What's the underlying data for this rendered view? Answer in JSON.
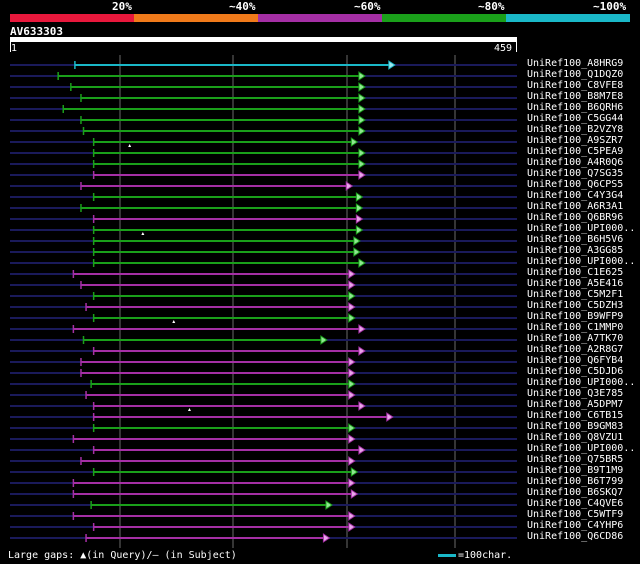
{
  "scale": {
    "labels": [
      "20%",
      "~40%",
      "~60%",
      "~80%",
      "~100%"
    ],
    "colors": [
      "#e8183c",
      "#f07a1a",
      "#a52fa5",
      "#1aa01a",
      "#1ab8c8"
    ]
  },
  "query": {
    "name": "AV633303",
    "start": "1",
    "end": "459",
    "length": 459
  },
  "colors": {
    "cyan": "#1ab8c8",
    "green": "#1aa01a",
    "purple": "#a52fa5",
    "navy": "#1a1a5a",
    "grid": "#6a6a6a"
  },
  "hits": [
    {
      "label": "UniRef100_A8HRG9",
      "start": 128,
      "end": 759,
      "color": "cyan"
    },
    {
      "label": "UniRef100_Q1DQZ0",
      "start": 95,
      "end": 700,
      "color": "green"
    },
    {
      "label": "UniRef100_C8VFE8",
      "start": 120,
      "end": 700,
      "color": "green"
    },
    {
      "label": "UniRef100_B8M7E8",
      "start": 140,
      "end": 700,
      "color": "green"
    },
    {
      "label": "UniRef100_B6QRH6",
      "start": 105,
      "end": 700,
      "color": "green"
    },
    {
      "label": "UniRef100_C5GG44",
      "start": 140,
      "end": 700,
      "color": "green"
    },
    {
      "label": "UniRef100_B2VZY8",
      "start": 145,
      "end": 700,
      "color": "green"
    },
    {
      "label": "UniRef100_A9SZR7",
      "start": 165,
      "end": 685,
      "color": "green"
    },
    {
      "label": "UniRef100_C5PEA9",
      "start": 165,
      "end": 700,
      "color": "green",
      "gap": 236
    },
    {
      "label": "UniRef100_A4R0Q6",
      "start": 165,
      "end": 700,
      "color": "green"
    },
    {
      "label": "UniRef100_Q7SG35",
      "start": 165,
      "end": 700,
      "color": "purple"
    },
    {
      "label": "UniRef100_Q6CPS5",
      "start": 140,
      "end": 675,
      "color": "purple"
    },
    {
      "label": "UniRef100_C4Y3G4",
      "start": 165,
      "end": 695,
      "color": "green"
    },
    {
      "label": "UniRef100_A6R3A1",
      "start": 140,
      "end": 695,
      "color": "green"
    },
    {
      "label": "UniRef100_Q6BR96",
      "start": 165,
      "end": 695,
      "color": "purple"
    },
    {
      "label": "UniRef100_UPI000..",
      "start": 165,
      "end": 695,
      "color": "green"
    },
    {
      "label": "UniRef100_B6H5V6",
      "start": 165,
      "end": 690,
      "color": "green",
      "gap": 262
    },
    {
      "label": "UniRef100_A3GG85",
      "start": 165,
      "end": 690,
      "color": "green"
    },
    {
      "label": "UniRef100_UPI000..",
      "start": 165,
      "end": 700,
      "color": "green"
    },
    {
      "label": "UniRef100_C1E625",
      "start": 125,
      "end": 680,
      "color": "purple"
    },
    {
      "label": "UniRef100_A5E416",
      "start": 140,
      "end": 680,
      "color": "purple"
    },
    {
      "label": "UniRef100_C5M2F1",
      "start": 165,
      "end": 680,
      "color": "green"
    },
    {
      "label": "UniRef100_C5DZH3",
      "start": 150,
      "end": 680,
      "color": "purple"
    },
    {
      "label": "UniRef100_B9WFP9",
      "start": 165,
      "end": 680,
      "color": "green"
    },
    {
      "label": "UniRef100_C1MMP0",
      "start": 125,
      "end": 700,
      "color": "purple",
      "gap": 323
    },
    {
      "label": "UniRef100_A7TK70",
      "start": 145,
      "end": 625,
      "color": "green"
    },
    {
      "label": "UniRef100_A2R8G7",
      "start": 165,
      "end": 700,
      "color": "purple"
    },
    {
      "label": "UniRef100_Q6FYB4",
      "start": 140,
      "end": 680,
      "color": "purple"
    },
    {
      "label": "UniRef100_C5DJD6",
      "start": 140,
      "end": 680,
      "color": "purple"
    },
    {
      "label": "UniRef100_UPI000..",
      "start": 160,
      "end": 680,
      "color": "green"
    },
    {
      "label": "UniRef100_Q3E785",
      "start": 150,
      "end": 680,
      "color": "purple"
    },
    {
      "label": "UniRef100_A5DPM7",
      "start": 165,
      "end": 700,
      "color": "purple"
    },
    {
      "label": "UniRef100_C6TB15",
      "start": 165,
      "end": 755,
      "color": "purple",
      "gap": 354
    },
    {
      "label": "UniRef100_B9GM83",
      "start": 165,
      "end": 680,
      "color": "green"
    },
    {
      "label": "UniRef100_Q8VZU1",
      "start": 125,
      "end": 680,
      "color": "purple"
    },
    {
      "label": "UniRef100_UPI000..",
      "start": 165,
      "end": 700,
      "color": "purple"
    },
    {
      "label": "UniRef100_Q75BR5",
      "start": 140,
      "end": 680,
      "color": "purple"
    },
    {
      "label": "UniRef100_B9T1M9",
      "start": 165,
      "end": 685,
      "color": "green"
    },
    {
      "label": "UniRef100_B6T799",
      "start": 125,
      "end": 680,
      "color": "purple"
    },
    {
      "label": "UniRef100_B6SKQ7",
      "start": 125,
      "end": 685,
      "color": "purple"
    },
    {
      "label": "UniRef100_C4QVE6",
      "start": 160,
      "end": 635,
      "color": "green"
    },
    {
      "label": "UniRef100_C5WTF9",
      "start": 125,
      "end": 680,
      "color": "purple"
    },
    {
      "label": "UniRef100_C4YHP6",
      "start": 165,
      "end": 680,
      "color": "purple"
    },
    {
      "label": "UniRef100_Q6CD86",
      "start": 150,
      "end": 630,
      "color": "purple"
    }
  ],
  "legend": {
    "text": "Large gaps: ▲(in Query)/– (in Subject)",
    "scale_text": "=100char."
  }
}
